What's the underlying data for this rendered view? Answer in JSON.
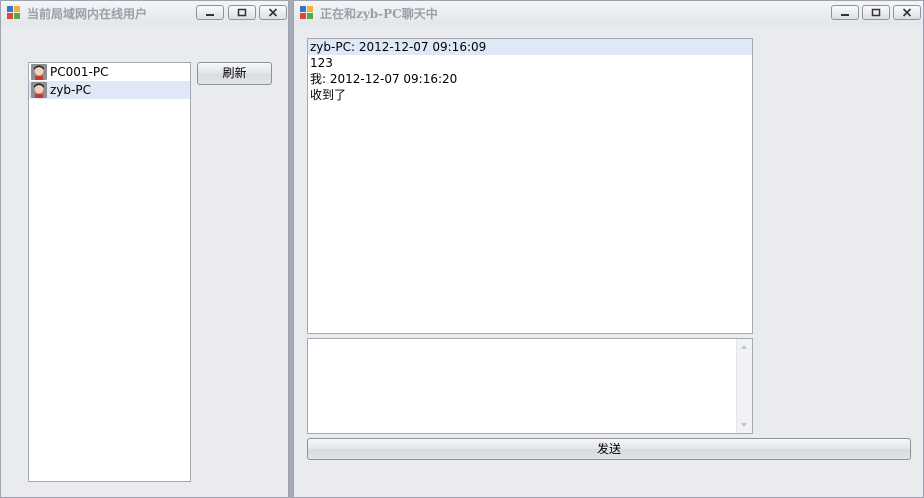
{
  "users_window": {
    "title": "当前局域网内在线用户",
    "refresh_label": "刷新",
    "users": [
      {
        "name": "PC001-PC",
        "selected": false
      },
      {
        "name": "zyb-PC",
        "selected": true
      }
    ]
  },
  "chat_window": {
    "title": "正在和zyb-PC聊天中",
    "messages": [
      "zyb-PC: 2012-12-07 09:16:09",
      "123",
      "我: 2012-12-07 09:16:20",
      "收到了"
    ],
    "input_value": "",
    "send_label": "发送"
  },
  "icons": {
    "window_icon": "app-window-icon",
    "minimize": "minimize-icon",
    "maximize": "maximize-icon",
    "close": "close-icon",
    "user_avatar": "user-avatar-icon"
  },
  "colors": {
    "window_bg": "#e9ebee",
    "selection": "#dfe8f7",
    "title_text": "#9aa0aa",
    "border": "#a5a9b1"
  }
}
